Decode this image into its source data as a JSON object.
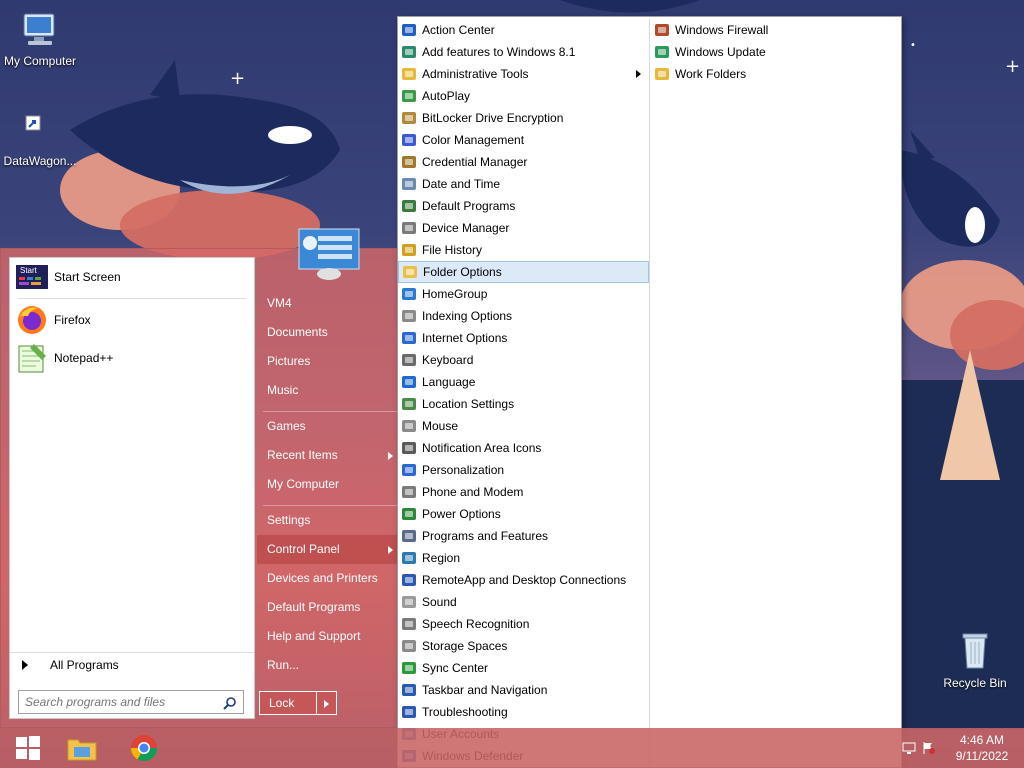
{
  "desktop": {
    "icons": [
      {
        "label": "My Computer"
      },
      {
        "label": "DataWagon..."
      },
      {
        "label": "Recycle Bin"
      }
    ]
  },
  "start_menu": {
    "pinned": [
      {
        "label": "Start Screen",
        "icon": "start-screen-icon",
        "badge": "Start"
      },
      {
        "label": "Firefox",
        "icon": "firefox-icon"
      },
      {
        "label": "Notepad++",
        "icon": "notepadpp-icon"
      }
    ],
    "all_programs": "All Programs",
    "search_placeholder": "Search programs and files",
    "right_items": [
      {
        "label": "VM4"
      },
      {
        "label": "Documents"
      },
      {
        "label": "Pictures"
      },
      {
        "label": "Music"
      },
      {
        "label": "Games"
      },
      {
        "label": "Recent Items",
        "submenu": true
      },
      {
        "label": "My Computer"
      },
      {
        "label": "Settings"
      },
      {
        "label": "Control Panel",
        "submenu": true,
        "active": true
      },
      {
        "label": "Devices and Printers"
      },
      {
        "label": "Default Programs"
      },
      {
        "label": "Help and Support"
      },
      {
        "label": "Run..."
      }
    ],
    "lock_label": "Lock"
  },
  "control_panel": {
    "column1": [
      {
        "label": "Action Center",
        "icon": "flag-icon"
      },
      {
        "label": "Add features to Windows 8.1",
        "icon": "add-features-icon"
      },
      {
        "label": "Administrative Tools",
        "icon": "folder-icon",
        "submenu": true
      },
      {
        "label": "AutoPlay",
        "icon": "autoplay-icon"
      },
      {
        "label": "BitLocker Drive Encryption",
        "icon": "bitlocker-icon"
      },
      {
        "label": "Color Management",
        "icon": "color-management-icon"
      },
      {
        "label": "Credential Manager",
        "icon": "credential-icon"
      },
      {
        "label": "Date and Time",
        "icon": "clock-icon"
      },
      {
        "label": "Default Programs",
        "icon": "default-programs-icon"
      },
      {
        "label": "Device Manager",
        "icon": "device-manager-icon"
      },
      {
        "label": "File History",
        "icon": "file-history-icon"
      },
      {
        "label": "Folder Options",
        "icon": "folder-options-icon",
        "highlight": true
      },
      {
        "label": "HomeGroup",
        "icon": "homegroup-icon"
      },
      {
        "label": "Indexing Options",
        "icon": "indexing-icon"
      },
      {
        "label": "Internet Options",
        "icon": "internet-icon"
      },
      {
        "label": "Keyboard",
        "icon": "keyboard-icon"
      },
      {
        "label": "Language",
        "icon": "language-icon"
      },
      {
        "label": "Location Settings",
        "icon": "location-icon"
      },
      {
        "label": "Mouse",
        "icon": "mouse-icon"
      },
      {
        "label": "Notification Area Icons",
        "icon": "notification-icon"
      },
      {
        "label": "Personalization",
        "icon": "personalization-icon"
      },
      {
        "label": "Phone and Modem",
        "icon": "phone-icon"
      },
      {
        "label": "Power Options",
        "icon": "power-icon"
      },
      {
        "label": "Programs and Features",
        "icon": "programs-icon"
      },
      {
        "label": "Region",
        "icon": "region-icon"
      },
      {
        "label": "RemoteApp and Desktop Connections",
        "icon": "remoteapp-icon"
      },
      {
        "label": "Sound",
        "icon": "sound-icon"
      },
      {
        "label": "Speech Recognition",
        "icon": "microphone-icon"
      },
      {
        "label": "Storage Spaces",
        "icon": "storage-icon"
      },
      {
        "label": "Sync Center",
        "icon": "sync-icon"
      },
      {
        "label": "Taskbar and Navigation",
        "icon": "taskbar-icon"
      },
      {
        "label": "Troubleshooting",
        "icon": "troubleshooting-icon"
      },
      {
        "label": "User Accounts",
        "icon": "user-accounts-icon"
      },
      {
        "label": "Windows Defender",
        "icon": "defender-icon"
      }
    ],
    "column2": [
      {
        "label": "Windows Firewall",
        "icon": "firewall-icon"
      },
      {
        "label": "Windows Update",
        "icon": "windows-update-icon"
      },
      {
        "label": "Work Folders",
        "icon": "work-folders-icon"
      }
    ]
  },
  "taskbar": {
    "time": "4:46 AM",
    "date": "9/11/2022"
  },
  "colors": {
    "start_menu_bg": "#d66868",
    "highlight": "#dce9f7",
    "taskbar": "#c86464"
  }
}
